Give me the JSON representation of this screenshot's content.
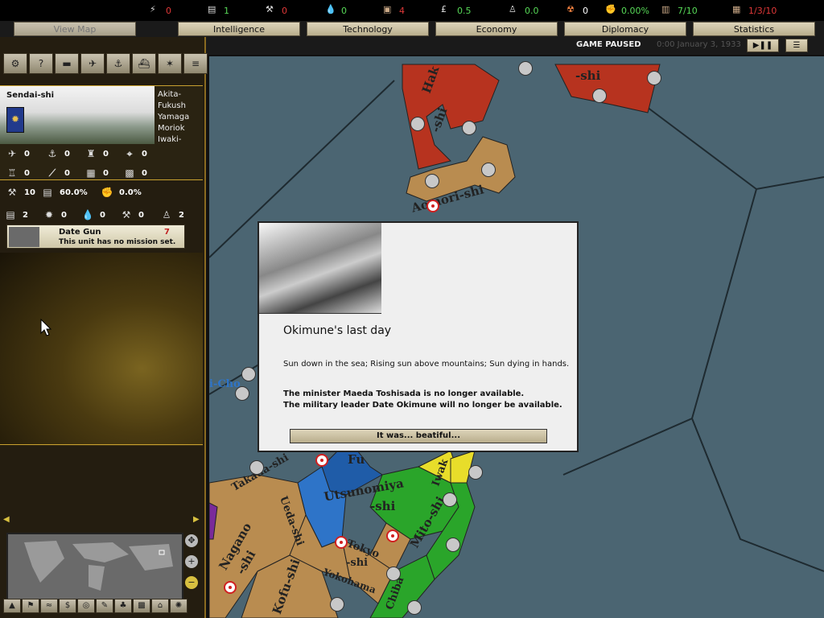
{
  "resources": [
    {
      "icon": "energy-icon",
      "value": "0",
      "color": "red"
    },
    {
      "icon": "metal-icon",
      "value": "1",
      "color": "green"
    },
    {
      "icon": "rare-materials-icon",
      "value": "0",
      "color": "red"
    },
    {
      "icon": "oil-icon",
      "value": "0",
      "color": "green"
    },
    {
      "icon": "supplies-icon",
      "value": "4",
      "color": "red"
    },
    {
      "icon": "money-icon",
      "value": "0.5",
      "color": "green"
    },
    {
      "icon": "manpower-icon",
      "value": "0.0",
      "color": "green"
    },
    {
      "icon": "nuke-icon",
      "value": "0",
      "color": "white"
    },
    {
      "icon": "dissent-icon",
      "value": "0.00%",
      "color": "green"
    },
    {
      "icon": "transports-icon",
      "value": "7/10",
      "color": "green"
    },
    {
      "icon": "escorts-icon",
      "value": "1/3/10",
      "color": "red"
    }
  ],
  "tabs": {
    "view_map": "View Map",
    "intelligence": "Intelligence",
    "technology": "Technology",
    "economy": "Economy",
    "diplomacy": "Diplomacy",
    "statistics": "Statistics"
  },
  "status": {
    "paused": "GAME PAUSED",
    "date": "0:00 January 3, 1933"
  },
  "province": {
    "name": "Sendai-shi",
    "neighbors": [
      "Akita-",
      "Fukush",
      "Yamaga",
      "Moriok",
      "Iwaki-"
    ],
    "stats_row1": [
      "0",
      "0",
      "0",
      "0"
    ],
    "stats_row2": [
      "0",
      "0",
      "0",
      "0"
    ],
    "stats_row3": {
      "a": "10",
      "b": "60.0%",
      "c": "0.0%"
    },
    "stats_row4": [
      "2",
      "0",
      "0",
      "0",
      "2"
    ]
  },
  "unit": {
    "name": "Date Gun",
    "mission": "This unit has no mission set.",
    "strength": "7"
  },
  "map_labels": [
    "Hak",
    "-shi",
    "-shi",
    "Aomori-shi",
    "Utsunomiya",
    "-shi",
    "Mito-shi",
    "Iwak",
    "Ueda-shi",
    "Takada-shi",
    "Tokyo",
    "-shi",
    "Yokohama",
    "Nagano",
    "-shi",
    "Kofu-shi",
    "Chiba",
    "Fu",
    "i-Cho"
  ],
  "event": {
    "title": "Okimune's last day",
    "description": "Sun down in the sea; Rising sun above mountains; Sun dying in hands.",
    "effect1": "The minister Maeda Toshisada is no longer available.",
    "effect2": "The military leader Date Okimune will no longer be available.",
    "button": "It was... beatiful..."
  }
}
